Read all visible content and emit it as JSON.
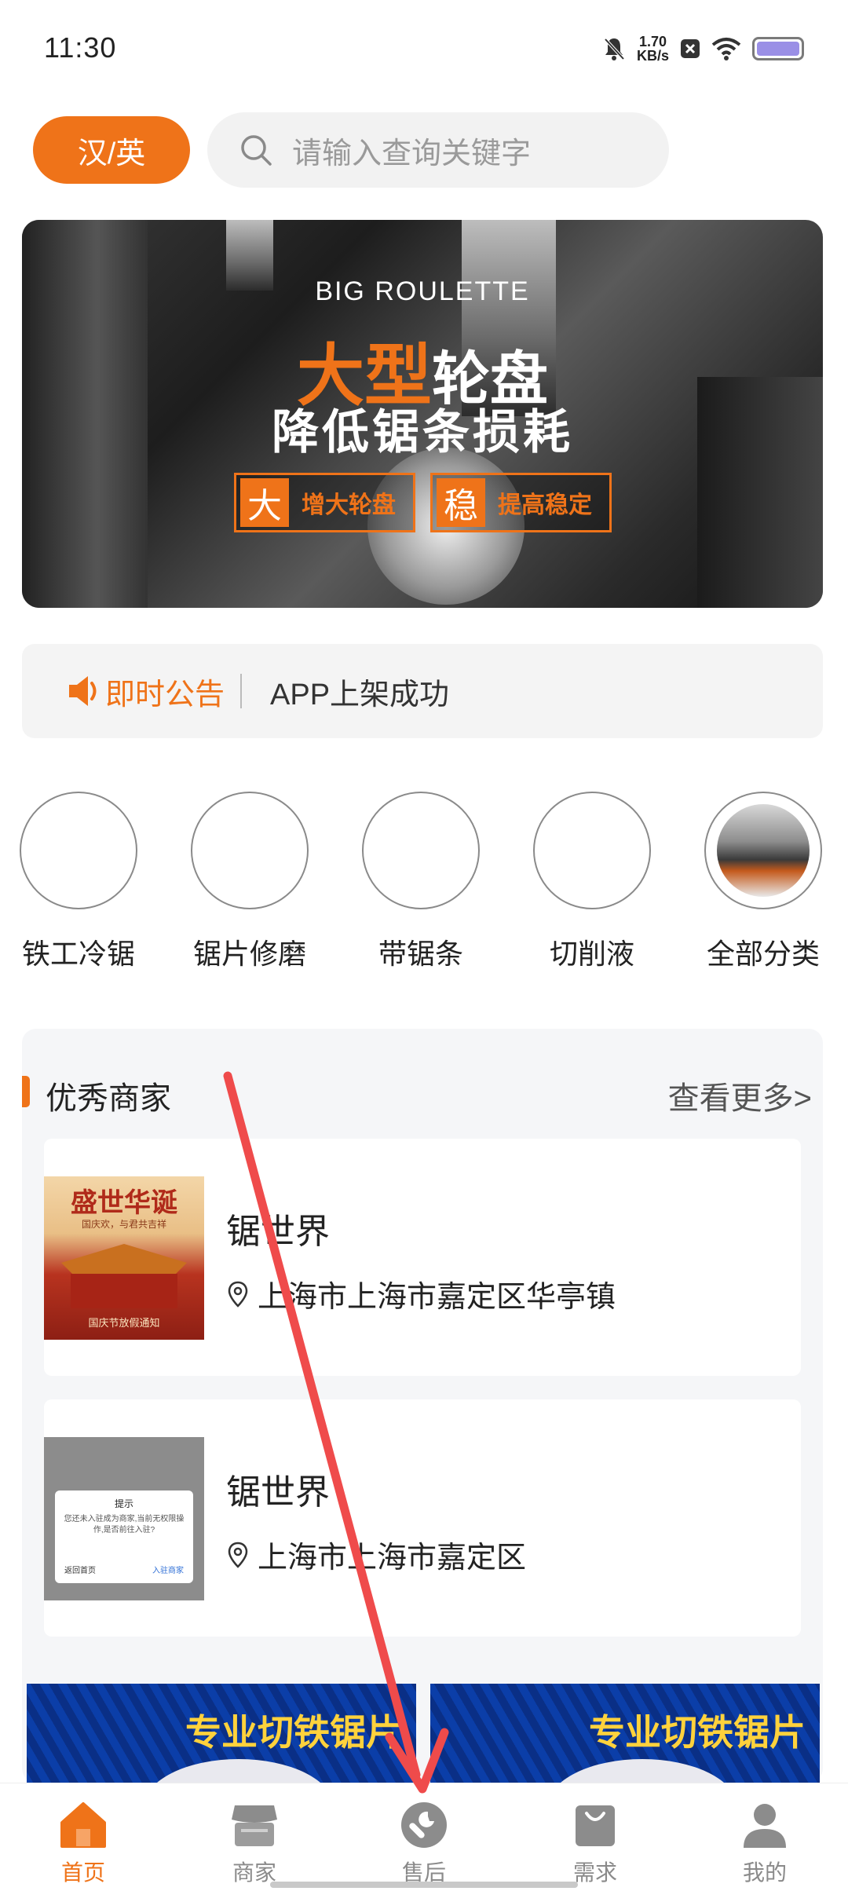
{
  "status_bar": {
    "time": "11:30",
    "net_speed_value": "1.70",
    "net_speed_unit": "KB/s",
    "icons": [
      "bell-muted-icon",
      "notification-x-icon",
      "wifi-icon",
      "battery-icon"
    ]
  },
  "header": {
    "lang_button": "汉/英",
    "search_placeholder": "请输入查询关键字"
  },
  "banner": {
    "english": "BIG ROULETTE",
    "line1_highlight": "大型",
    "line1_rest": "轮盘",
    "line2": "降低锯条损耗",
    "tags": [
      {
        "key": "大",
        "text": "增大轮盘"
      },
      {
        "key": "稳",
        "text": "提高稳定"
      }
    ]
  },
  "notice": {
    "label": "即时公告",
    "message": "APP上架成功"
  },
  "categories": [
    {
      "label": "铁工冷锯"
    },
    {
      "label": "锯片修磨"
    },
    {
      "label": "带锯条"
    },
    {
      "label": "切削液"
    },
    {
      "label": "全部分类"
    }
  ],
  "merchants": {
    "title": "优秀商家",
    "more": "查看更多>",
    "items": [
      {
        "name": "锯世界",
        "address": "上海市上海市嘉定区华亭镇",
        "thumb_title": "盛世华诞",
        "thumb_sub": "国庆欢，与君共吉祥",
        "thumb_bottom": "国庆节放假通知"
      },
      {
        "name": "锯世界",
        "address": "上海市上海市嘉定区",
        "dialog_title": "提示",
        "dialog_msg": "您还未入驻成为商家,当前无权限操作,是否前往入驻?",
        "dialog_back": "返回首页",
        "dialog_join": "入驻商家"
      }
    ]
  },
  "promos": [
    {
      "text": "专业切铁锯片"
    },
    {
      "text": "专业切铁锯片"
    }
  ],
  "tabbar": {
    "items": [
      {
        "label": "首页",
        "icon": "home-icon",
        "active": true
      },
      {
        "label": "商家",
        "icon": "shop-icon",
        "active": false
      },
      {
        "label": "售后",
        "icon": "wrench-icon",
        "active": false
      },
      {
        "label": "需求",
        "icon": "bag-icon",
        "active": false
      },
      {
        "label": "我的",
        "icon": "user-icon",
        "active": false
      }
    ]
  },
  "colors": {
    "accent": "#ef7319",
    "annotation_arrow": "#ef4b4b"
  }
}
